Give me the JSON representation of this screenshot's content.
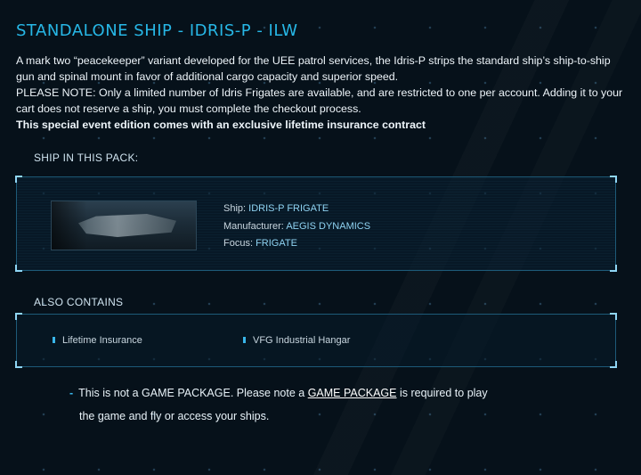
{
  "page": {
    "title": "STANDALONE SHIP - IDRIS-P - ILW",
    "description_line1": "A mark two “peacekeeper” variant developed for the UEE patrol services, the Idris-P strips the standard ship’s ship-to-ship gun and spinal mount in favor of additional cargo capacity and superior speed.",
    "description_line2": "PLEASE NOTE: Only a limited number of Idris Frigates are available, and are restricted to one per account. Adding it to your cart does not reserve a ship, you must complete the checkout process.",
    "description_bold": "This special event edition comes with an exclusive lifetime insurance contract"
  },
  "ship_section": {
    "label": "SHIP IN THIS PACK:",
    "ship_key": "Ship:",
    "ship_value": "IDRIS-P FRIGATE",
    "manufacturer_key": "Manufacturer:",
    "manufacturer_value": "AEGIS DYNAMICS",
    "focus_key": "Focus:",
    "focus_value": "FRIGATE"
  },
  "contains_section": {
    "label": "ALSO CONTAINS",
    "items": [
      "Lifetime Insurance",
      "VFG Industrial Hangar"
    ]
  },
  "note": {
    "text_before": "This is not a GAME PACKAGE. Please note a ",
    "link": "GAME PACKAGE",
    "text_after": " is required to play",
    "line2": "the game and fly or access your ships."
  },
  "colors": {
    "accent": "#27b7e6",
    "value": "#8fd3f2",
    "background": "#06111a"
  }
}
